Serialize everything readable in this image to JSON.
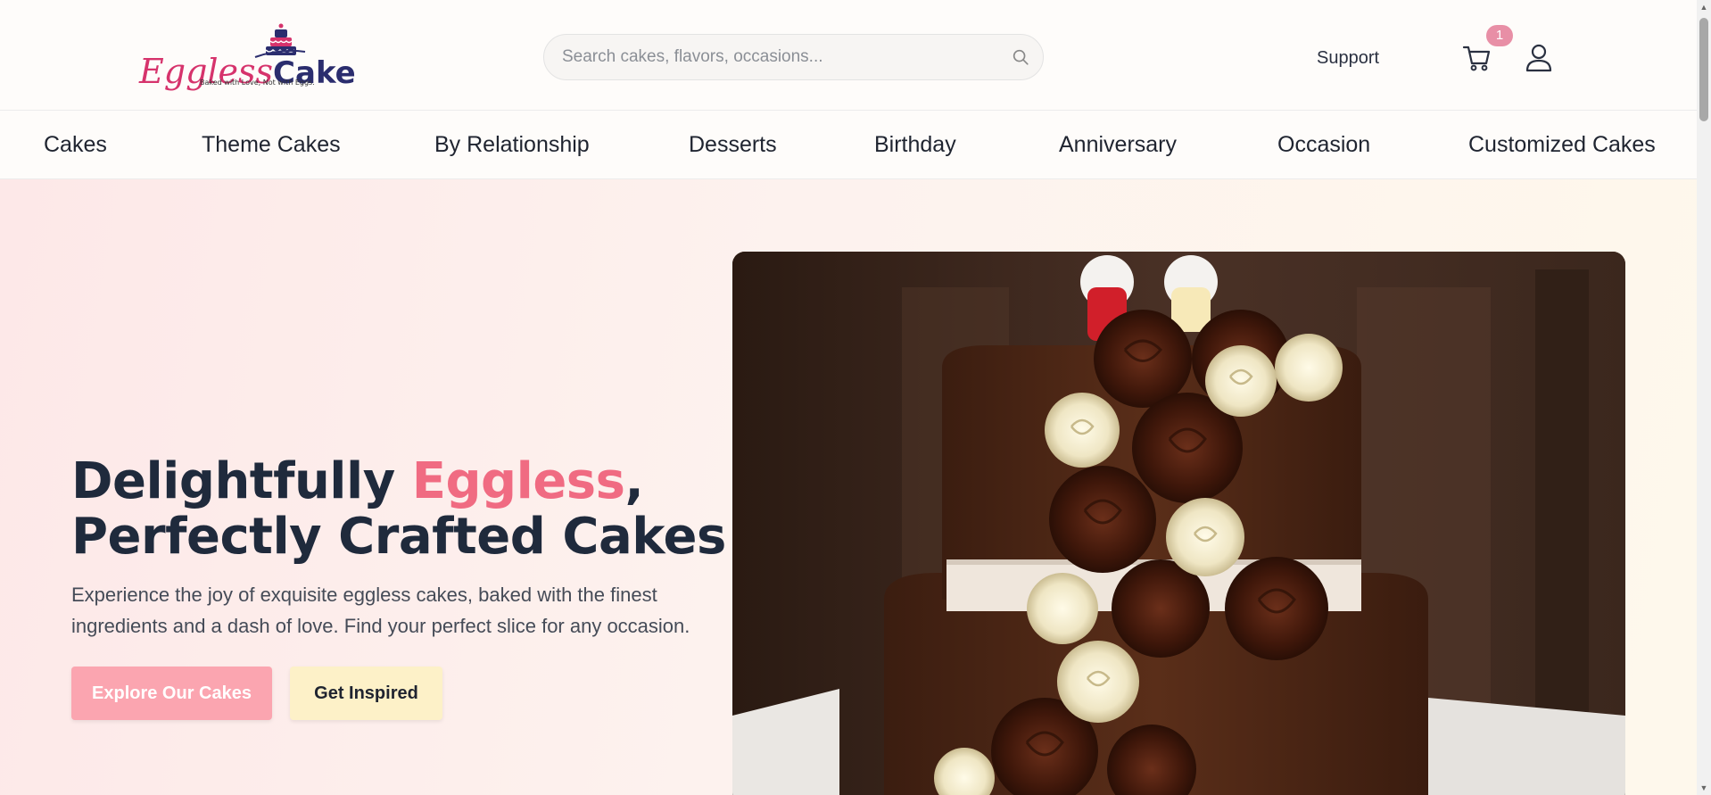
{
  "brand": {
    "name_part1": "Eggless",
    "name_part2": "Cake",
    "tagline": "Baked with Love, Not with Eggs."
  },
  "search": {
    "placeholder": "Search cakes, flavors, occasions...",
    "value": ""
  },
  "header": {
    "support_label": "Support",
    "cart_count": "1"
  },
  "nav": {
    "items": [
      {
        "label": "Cakes"
      },
      {
        "label": "Theme Cakes"
      },
      {
        "label": "By Relationship"
      },
      {
        "label": "Desserts"
      },
      {
        "label": "Birthday"
      },
      {
        "label": "Anniversary"
      },
      {
        "label": "Occasion"
      },
      {
        "label": "Customized Cakes"
      }
    ]
  },
  "hero": {
    "headline_part1": "Delightfully ",
    "headline_accent": "Eggless",
    "headline_part2": ",",
    "headline_line2": "Perfectly Crafted Cakes",
    "subtitle": "Experience the joy of exquisite eggless cakes, baked with the finest ingredients and a dash of love. Find your perfect slice for any occasion.",
    "primary_button": "Explore Our Cakes",
    "secondary_button": "Get Inspired"
  },
  "colors": {
    "accent_pink": "#f06b82",
    "button_pink": "#fba5b0",
    "button_cream": "#fdf1c8",
    "badge_pink": "#e88fa6",
    "heading_navy": "#1f2a3c"
  }
}
